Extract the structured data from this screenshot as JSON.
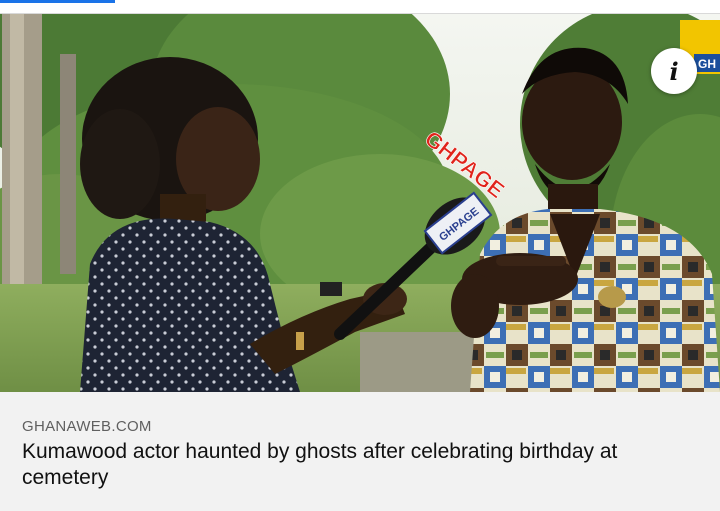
{
  "article": {
    "source": "GHANAWEB.COM",
    "headline": "Kumawood actor haunted by ghosts after celebrating birthday at cemetery"
  },
  "image": {
    "watermark_text": "GHPAGE",
    "mic_flag_text": "GHPAGE",
    "channel_logo_text": "GH"
  },
  "info_button": {
    "icon": "info-icon",
    "label": "i"
  },
  "colors": {
    "accent": "#1a73e8",
    "caption_bg": "#f2f2f2",
    "watermark": "#e0241b",
    "source_text": "#606060",
    "headline_text": "#111111"
  }
}
